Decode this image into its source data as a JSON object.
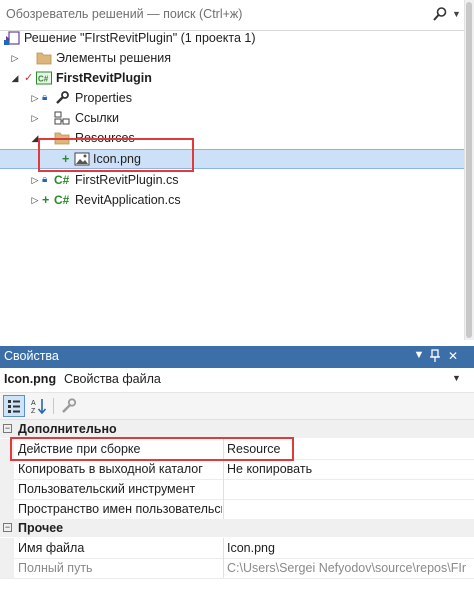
{
  "search": {
    "placeholder": "Обозреватель решений — поиск (Ctrl+ж)"
  },
  "tree": {
    "solution": "Решение \"FIrstRevitPlugin\" (1 проекта 1)",
    "solution_items": "Элементы решения",
    "project": "FirstRevitPlugin",
    "properties": "Properties",
    "references": "Ссылки",
    "resources": "Resources",
    "icon_file": "Icon.png",
    "file1": "FirstRevitPlugin.cs",
    "file2": "RevitApplication.cs"
  },
  "properties_panel": {
    "title": "Свойства",
    "object_name": "Icon.png",
    "object_type": "Свойства файла",
    "category_advanced": "Дополнительно",
    "category_misc": "Прочее",
    "rows": [
      {
        "name": "Действие при сборке",
        "value": "Resource"
      },
      {
        "name": "Копировать в выходной каталог",
        "value": "Не копировать"
      },
      {
        "name": "Пользовательский инструмент",
        "value": ""
      },
      {
        "name": "Пространство имен пользовательского",
        "value": ""
      }
    ],
    "misc_rows": [
      {
        "name": "Имя файла",
        "value": "Icon.png"
      },
      {
        "name": "Полный путь",
        "value": "C:\\Users\\Sergei Nefyodov\\source\\repos\\FIr"
      }
    ]
  },
  "colors": {
    "accent": "#3c6ea8",
    "selection": "#cce0f7",
    "highlight": "#e03a3a",
    "csharp": "#2a8a2a"
  }
}
